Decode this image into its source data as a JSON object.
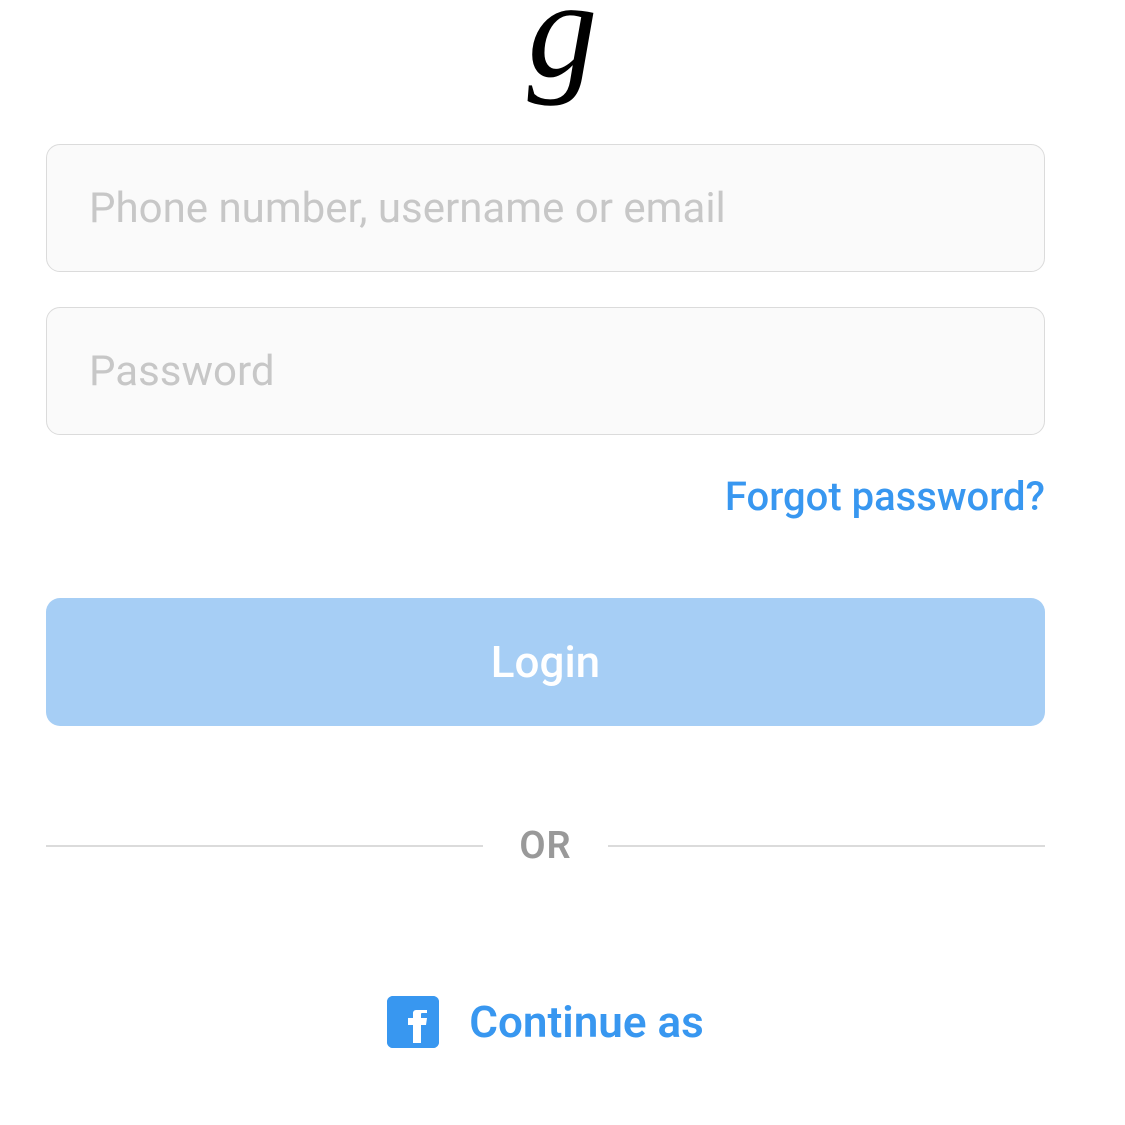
{
  "logo": {
    "visible_fragment": "g"
  },
  "form": {
    "username_placeholder": "Phone number, username or email",
    "username_value": "",
    "password_placeholder": "Password",
    "password_value": "",
    "forgot_label": "Forgot password?",
    "login_label": "Login"
  },
  "divider": {
    "label": "OR"
  },
  "facebook": {
    "label": "Continue as"
  },
  "colors": {
    "primary_blue": "#3897f0",
    "button_blue_disabled": "#a6cef5",
    "input_bg": "#fafafa",
    "border": "#dbdbdb",
    "placeholder": "#c7c7c7",
    "divider_text": "#999"
  }
}
